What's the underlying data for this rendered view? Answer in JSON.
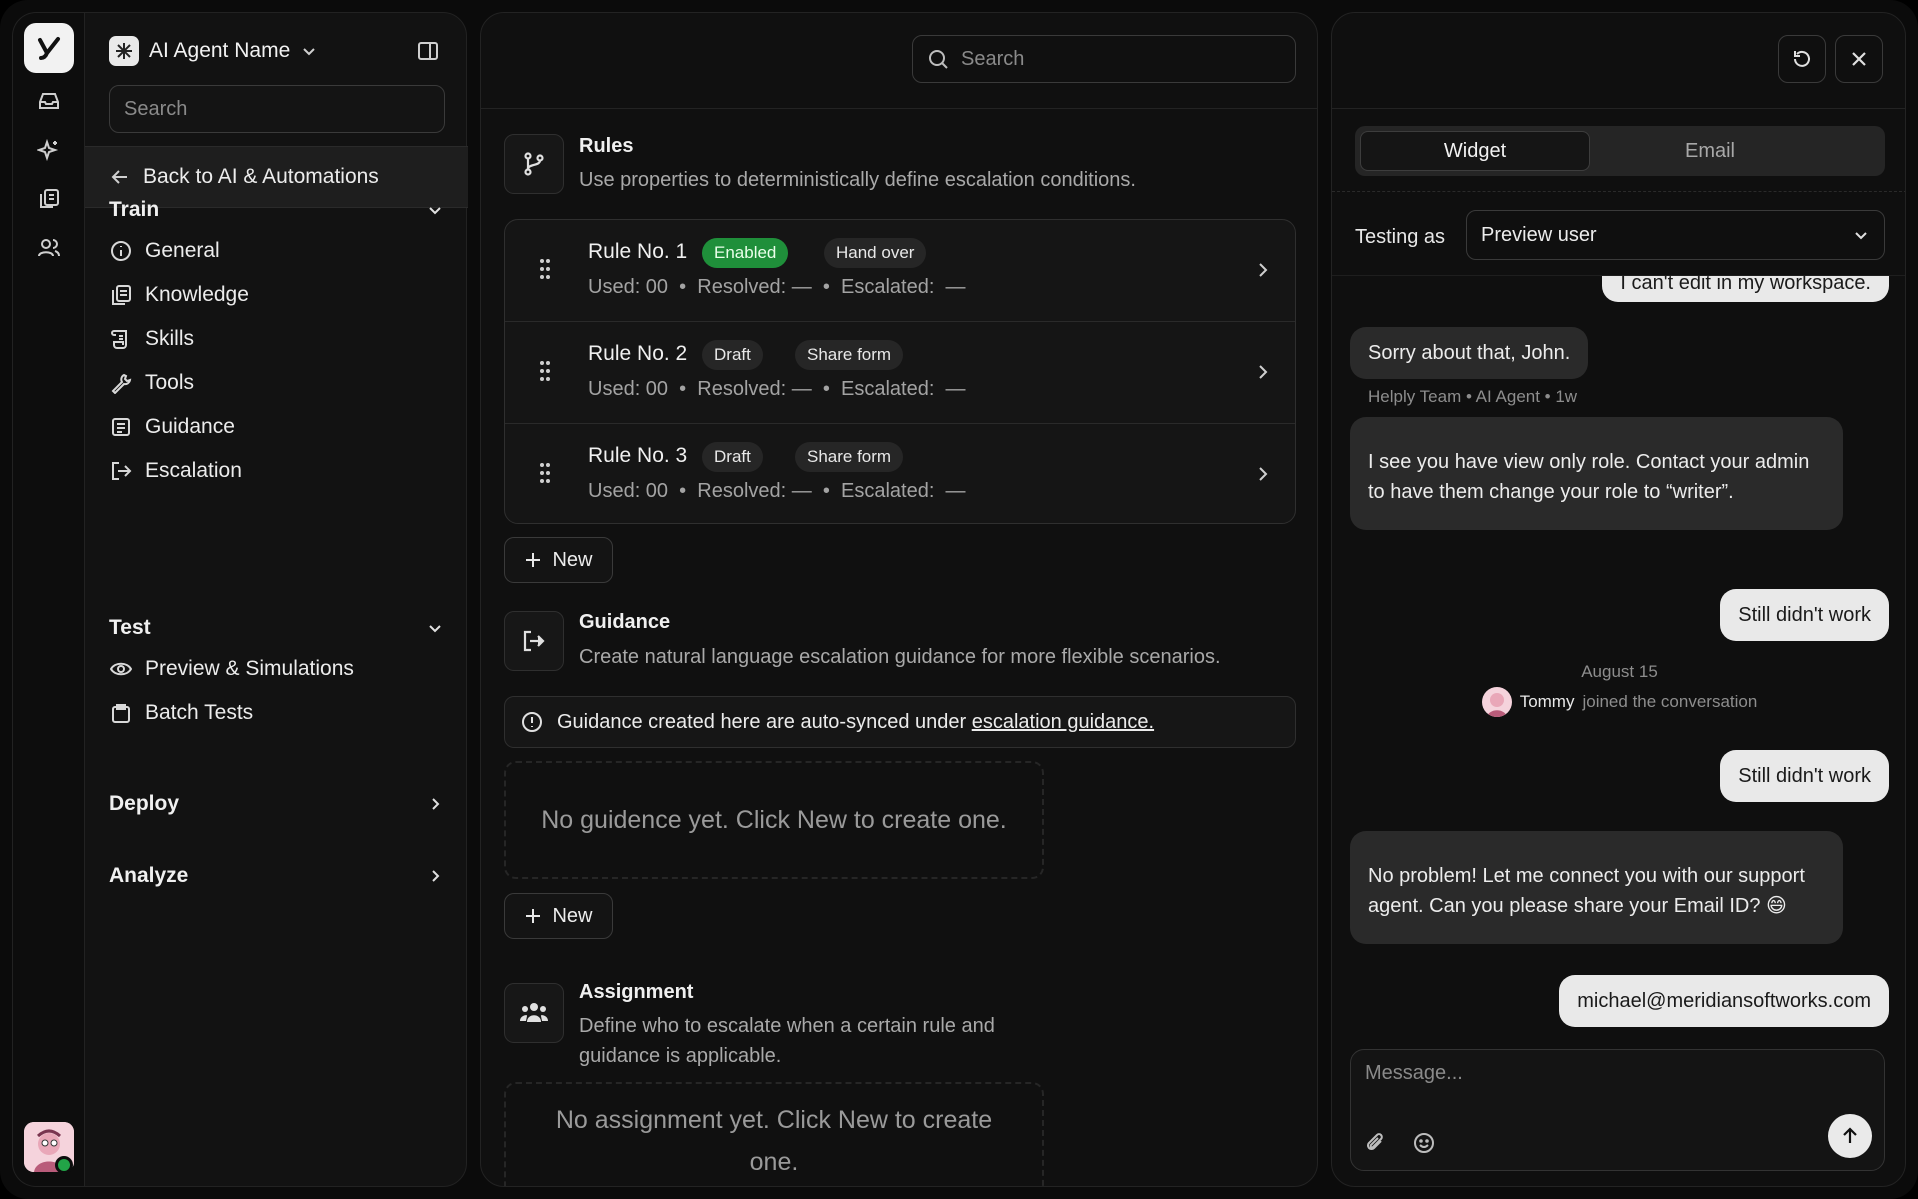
{
  "sidebar": {
    "agent_name": "AI Agent Name",
    "search_placeholder": "Search",
    "back_label": "Back to AI & Automations",
    "sections": {
      "train": "Train",
      "test": "Test",
      "deploy": "Deploy",
      "analyze": "Analyze"
    },
    "train_items": [
      {
        "label": "General",
        "icon": "info-icon"
      },
      {
        "label": "Knowledge",
        "icon": "knowledge-icon"
      },
      {
        "label": "Skills",
        "icon": "scroll-icon"
      },
      {
        "label": "Tools",
        "icon": "wrench-icon"
      },
      {
        "label": "Guidance",
        "icon": "document-icon"
      },
      {
        "label": "Escalation",
        "icon": "exit-icon"
      }
    ],
    "test_items": [
      {
        "label": "Preview & Simulations",
        "icon": "eye-icon"
      },
      {
        "label": "Batch Tests",
        "icon": "clipboard-icon"
      }
    ]
  },
  "main": {
    "search_placeholder": "Search",
    "rules_section": {
      "title": "Rules",
      "description": "Use properties to deterministically define escalation conditions."
    },
    "rules": [
      {
        "name": "Rule No. 1",
        "status": "Enabled",
        "tag": "Hand over",
        "stats": "Used: 00  •  Resolved: —  •  Escalated:  —"
      },
      {
        "name": "Rule No. 2",
        "status": "Draft",
        "tag": "Share form",
        "stats": "Used: 00  •  Resolved: —  •  Escalated:  —"
      },
      {
        "name": "Rule No. 3",
        "status": "Draft",
        "tag": "Share form",
        "stats": "Used: 00  •  Resolved: —  •  Escalated:  —"
      }
    ],
    "new_label": "New",
    "guidance_section": {
      "title": "Guidance",
      "description": "Create natural language escalation guidance for more flexible scenarios."
    },
    "notice": {
      "text": "Guidance created here are auto-synced under",
      "link": "escalation guidance."
    },
    "guidance_empty": "No guidence yet. Click New to create one.",
    "assignment_section": {
      "title": "Assignment",
      "description": "Define who to escalate when a certain rule and guidance is applicable."
    },
    "assignment_empty": "No assignment yet. Click New to create one."
  },
  "preview": {
    "tabs": [
      "Widget",
      "Email"
    ],
    "active_tab": "Widget",
    "testing_as_label": "Testing as",
    "testing_as_value": "Preview user",
    "messages": {
      "partial_out": "I can't edit in my workspace.",
      "sorry": "Sorry about that, John.",
      "sender_meta": "Helply Team • AI Agent • 1w",
      "view_only": "I see you have view only role. Contact your admin to have them change your role to “writer”.",
      "still1": "Still didn't work",
      "date": "August 15",
      "joined_name": "Tommy",
      "joined_text": "joined the conversation",
      "still2": "Still didn't work",
      "no_problem": "No problem! Let me connect you with our support agent. Can you please share your Email ID? 😄",
      "email": "michael@meridiansoftworks.com"
    },
    "composer_placeholder": "Message..."
  },
  "colors": {
    "background": "#0b0b0b",
    "panel": "#121212",
    "enabled_badge": "#1f8f3a",
    "status_online": "#22a447",
    "outgoing_bubble": "#e9e9e9",
    "incoming_bubble": "#2a2a2a"
  }
}
